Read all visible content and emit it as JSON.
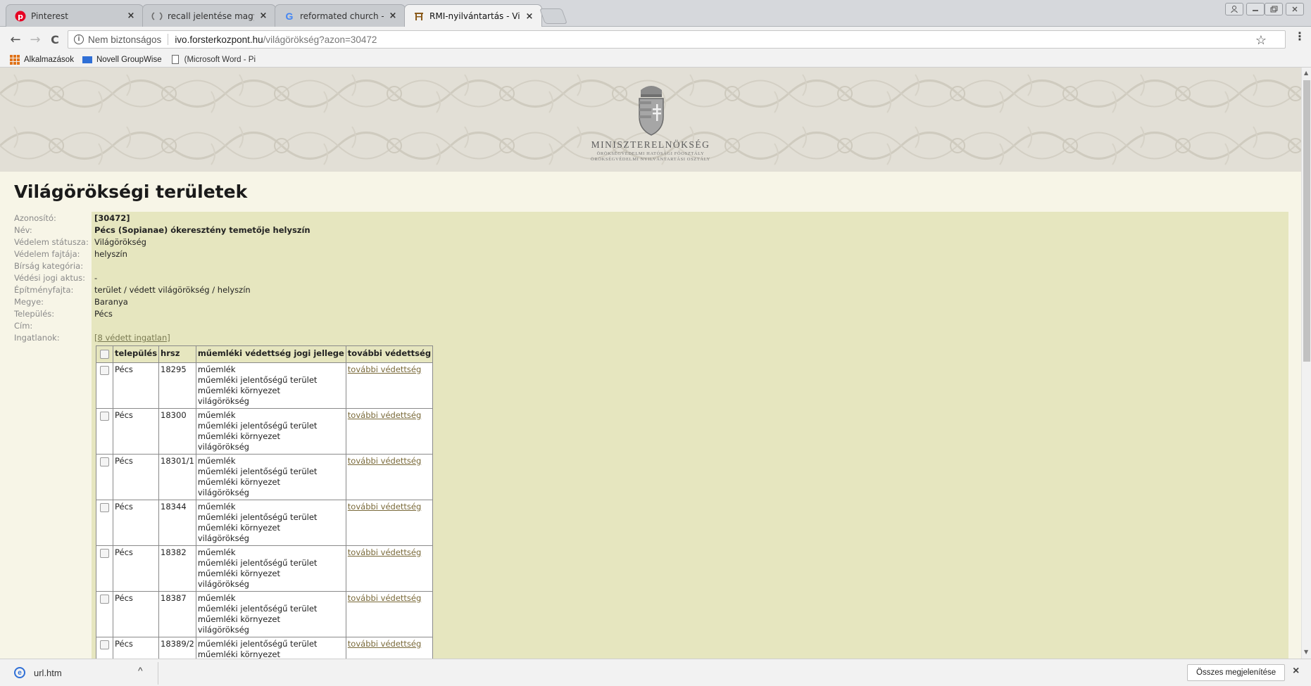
{
  "tabs": [
    {
      "title": "Pinterest",
      "icon": "pinterest-icon",
      "icon_color": "#e60023",
      "close": "×"
    },
    {
      "title": "recall jelentése magyarul",
      "icon": "loading-icon",
      "icon_color": "#6b6b6b",
      "close": "×"
    },
    {
      "title": "reformated church - Goo",
      "icon": "google-icon",
      "icon_color": "#4285f4",
      "close": "×"
    },
    {
      "title": "RMI-nyilvántartás - Világ",
      "icon": "gate-icon",
      "icon_color": "#8a5a1a",
      "close": "×"
    }
  ],
  "window_controls": [
    "user-icon",
    "minimize-icon",
    "restore-icon",
    "close-icon"
  ],
  "toolbar": {
    "back": "←",
    "forward": "→",
    "reload": "C",
    "security_text": "Nem biztonságos",
    "url_host": "ivo.forsterkozpont.hu",
    "url_path": "/világörökség?azon=30472",
    "star": "☆",
    "menu": "⋮"
  },
  "bookmarks": [
    {
      "label": "Alkalmazások",
      "icon": "apps-icon"
    },
    {
      "label": "Novell GroupWise",
      "icon": "mail-icon"
    },
    {
      "label": "(Microsoft Word - Pi",
      "icon": "document-icon"
    }
  ],
  "banner": {
    "title": "MINISZTERELNÖKSÉG",
    "sub1": "ÖRÖKSÉGVÉDELMI HATÓSÁGI FŐOSZTÁLY",
    "sub2": "ÖRÖKSÉGVÉDELMI NYILVÁNTARTÁSI OSZTÁLY"
  },
  "page": {
    "title": "Világörökségi területek"
  },
  "fields": [
    {
      "label": "Azonosító:",
      "value": "[30472]",
      "bold": true
    },
    {
      "label": "Név:",
      "value": "Pécs (Sopianae) ókeresztény temetője helyszín",
      "bold": true
    },
    {
      "label": "Védelem státusza:",
      "value": "Világörökség"
    },
    {
      "label": "Védelem fajtája:",
      "value": "helyszín"
    },
    {
      "label": "Bírság kategória:",
      "value": ""
    },
    {
      "label": "Védési jogi aktus:",
      "value": "-"
    },
    {
      "label": "Építményfajta:",
      "value": "terület / védett világörökség / helyszín"
    },
    {
      "label": "Megye:",
      "value": "Baranya"
    },
    {
      "label": "Település:",
      "value": "Pécs"
    },
    {
      "label": "Cím:",
      "value": ""
    },
    {
      "label": "Ingatlanok:",
      "value": "[8 védett ingatlan]",
      "link": true
    }
  ],
  "table": {
    "headers": [
      "település",
      "hrsz",
      "műemléki védettség jogi jellege",
      "további védettség"
    ],
    "rows": [
      {
        "town": "Pécs",
        "hrsz": "18295",
        "types": [
          "műemlék",
          "műemléki jelentőségű terület",
          "műemléki környezet",
          "világörökség"
        ],
        "link": "további védettség"
      },
      {
        "town": "Pécs",
        "hrsz": "18300",
        "types": [
          "műemlék",
          "műemléki jelentőségű terület",
          "műemléki környezet",
          "világörökség"
        ],
        "link": "további védettség"
      },
      {
        "town": "Pécs",
        "hrsz": "18301/1",
        "types": [
          "műemlék",
          "műemléki jelentőségű terület",
          "műemléki környezet",
          "világörökség"
        ],
        "link": "további védettség"
      },
      {
        "town": "Pécs",
        "hrsz": "18344",
        "types": [
          "műemlék",
          "műemléki jelentőségű terület",
          "műemléki környezet",
          "világörökség"
        ],
        "link": "további védettség"
      },
      {
        "town": "Pécs",
        "hrsz": "18382",
        "types": [
          "műemlék",
          "műemléki jelentőségű terület",
          "műemléki környezet",
          "világörökség"
        ],
        "link": "további védettség"
      },
      {
        "town": "Pécs",
        "hrsz": "18387",
        "types": [
          "műemlék",
          "műemléki jelentőségű terület",
          "műemléki környezet",
          "világörökség"
        ],
        "link": "további védettség"
      },
      {
        "town": "Pécs",
        "hrsz": "18389/2",
        "types": [
          "műemléki jelentőségű terület",
          "műemléki környezet"
        ],
        "link": "további védettség"
      }
    ]
  },
  "downloads": {
    "file": "url.htm",
    "chevron": "^",
    "show_all": "Összes megjelenítése",
    "close": "×"
  }
}
